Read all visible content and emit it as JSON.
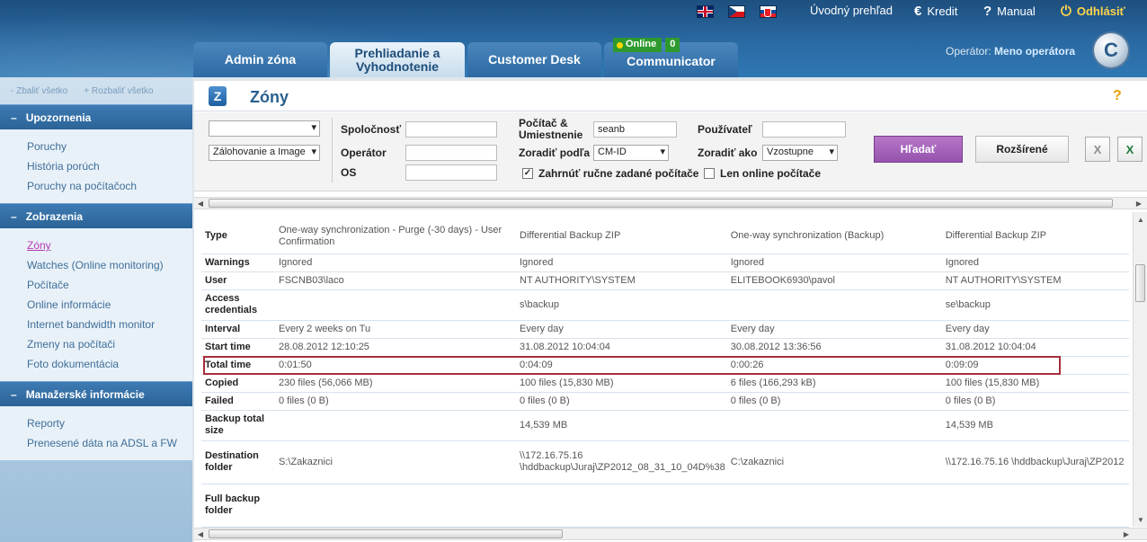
{
  "header": {
    "flags": [
      "english-flag",
      "czech-flag",
      "slovak-flag"
    ],
    "links": {
      "overview": "Úvodný prehľad",
      "credit": "Kredit",
      "manual": "Manual",
      "logout": "Odhlásiť"
    },
    "tabs": [
      {
        "label": "Admin zóna"
      },
      {
        "label": "Prehliadanie a Vyhodnotenie",
        "active": true
      },
      {
        "label": "Customer Desk"
      },
      {
        "label": "Communicator"
      }
    ],
    "online_badge": {
      "label": "Online",
      "count": "0"
    },
    "operator_label": "Operátor:",
    "operator_name": "Meno operátora",
    "logo_letter": "C"
  },
  "sidebar": {
    "collapse_all": "Zbaliť všetko",
    "expand_all": "Rozbaliť všetko",
    "sections": [
      {
        "title": "Upozornenia",
        "items": [
          "Poruchy",
          "História porúch",
          "Poruchy na počítačoch"
        ]
      },
      {
        "title": "Zobrazenia",
        "items": [
          "Zóny",
          "Watches (Online monitoring)",
          "Počítače",
          "Online informácie",
          "Internet bandwidth monitor",
          "Zmeny na počítači",
          "Foto dokumentácia"
        ]
      },
      {
        "title": "Manažerské informácie",
        "items": [
          "Reporty",
          "Prenesené dáta na ADSL a FW"
        ]
      }
    ]
  },
  "page": {
    "title": "Zóny",
    "help": "?"
  },
  "filters": {
    "select1_value": "",
    "select2_value": "Zálohovanie a Image",
    "company_label": "Spoločnosť",
    "company_value": "",
    "operator_label": "Operátor",
    "operator_value": "",
    "os_label": "OS",
    "os_value": "",
    "computer_label": "Počítač & Umiestnenie",
    "computer_value": "seanb",
    "sort_by_label": "Zoradiť podľa",
    "sort_by_value": "CM-ID",
    "include_manual_label": "Zahrnúť ručne zadané počítače",
    "include_manual_checked": true,
    "user_label": "Používateľ",
    "user_value": "",
    "sort_as_label": "Zoradiť ako",
    "sort_as_value": "Vzostupne",
    "online_only_label": "Len online počítače",
    "online_only_checked": false,
    "search_button": "Hľadať",
    "advanced_button": "Rozšírené",
    "excel_icon": "X"
  },
  "table": {
    "rows": [
      {
        "key": "Type",
        "values": [
          "One-way synchronization - Purge (-30 days) - User Confirmation",
          "Differential Backup ZIP",
          "One-way synchronization (Backup)",
          "Differential Backup ZIP"
        ]
      },
      {
        "key": "Warnings",
        "values": [
          "Ignored",
          "Ignored",
          "Ignored",
          "Ignored"
        ]
      },
      {
        "key": "User",
        "values": [
          "FSCNB03\\laco",
          "NT AUTHORITY\\SYSTEM",
          "ELITEBOOK6930\\pavol",
          "NT AUTHORITY\\SYSTEM"
        ]
      },
      {
        "key": "Access credentials",
        "values": [
          "",
          "s\\backup",
          "",
          "se\\backup"
        ]
      },
      {
        "key": "Interval",
        "values": [
          "Every 2 weeks on Tu",
          "Every day",
          "Every day",
          "Every day"
        ]
      },
      {
        "key": "Start time",
        "values": [
          "28.08.2012 12:10:25",
          "31.08.2012 10:04:04",
          "30.08.2012 13:36:56",
          "31.08.2012 10:04:04"
        ]
      },
      {
        "key": "Total time",
        "values": [
          "0:01:50",
          "0:04:09",
          "0:00:26",
          "0:09:09"
        ]
      },
      {
        "key": "Copied",
        "values": [
          "230 files (56,066 MB)",
          "100 files (15,830 MB)",
          "6 files (166,293 kB)",
          "100 files (15,830 MB)"
        ]
      },
      {
        "key": "Failed",
        "values": [
          "0 files (0 B)",
          "0 files (0 B)",
          "0 files (0 B)",
          "0 files (0 B)"
        ]
      },
      {
        "key": "Backup total size",
        "values": [
          "",
          "14,539 MB",
          "",
          "14,539 MB"
        ]
      },
      {
        "key": "Destination folder",
        "values": [
          "S:\\Zakaznici",
          "\\\\172.16.75.16 \\hddbackup\\Juraj\\ZP2012_08_31_10_04D%38",
          "C:\\zakaznici",
          "\\\\172.16.75.16 \\hddbackup\\Juraj\\ZP2012"
        ]
      },
      {
        "key": "Full backup folder",
        "values": [
          "",
          "",
          "",
          ""
        ]
      }
    ],
    "highlighted_row": "Total time"
  }
}
